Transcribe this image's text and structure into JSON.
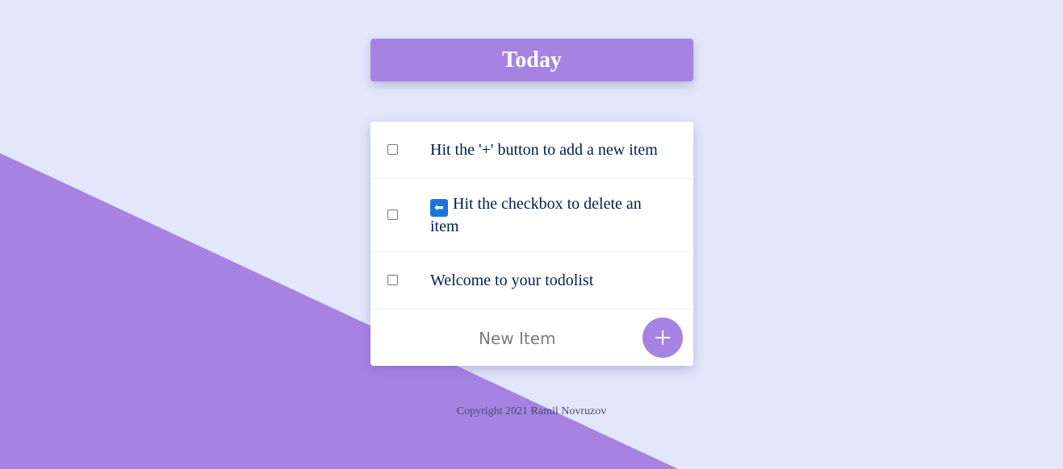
{
  "theme": {
    "background": "#E3E7FB",
    "accent": "#A683E3",
    "text": "#00204A"
  },
  "heading": {
    "title": "Today"
  },
  "items": [
    {
      "text": "Hit the '+' button to add a new item",
      "checked": false
    },
    {
      "icon": "left-arrow-icon",
      "icon_glyph": "⬅",
      "text": "Hit the checkbox to delete an item",
      "checked": false
    },
    {
      "text": "Welcome to your todolist",
      "checked": false
    }
  ],
  "new_item": {
    "placeholder": "New Item",
    "value": "",
    "add_button_icon": "plus-icon"
  },
  "footer": {
    "copyright": "Copyright 2021 Ramil Novruzov"
  }
}
